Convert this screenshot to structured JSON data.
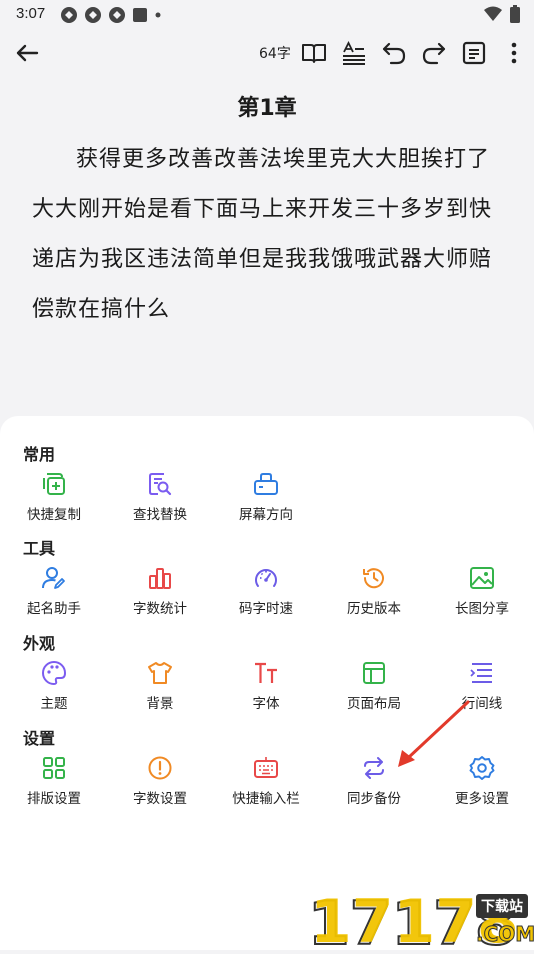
{
  "status": {
    "time": "3:07"
  },
  "toolbar": {
    "word_count": "64字"
  },
  "chapter": {
    "title": "第1章",
    "body": "获得更多改善改善法埃里克大大胆挨打了大大刚开始是看下面马上来开发三十多岁到快递店为我区违法简单但是我我饿哦武器大师赔偿款在搞什么"
  },
  "sheet": {
    "sections": [
      {
        "title": "常用",
        "items": [
          {
            "label": "快捷复制",
            "icon": "copy-add-icon",
            "color": "#34b34a"
          },
          {
            "label": "查找替换",
            "icon": "find-replace-icon",
            "color": "#7b5cf0"
          },
          {
            "label": "屏幕方向",
            "icon": "screen-rotate-icon",
            "color": "#2f7de1"
          }
        ]
      },
      {
        "title": "工具",
        "items": [
          {
            "label": "起名助手",
            "icon": "user-edit-icon",
            "color": "#2f7de1"
          },
          {
            "label": "字数统计",
            "icon": "bar-chart-icon",
            "color": "#e84848"
          },
          {
            "label": "码字时速",
            "icon": "speedometer-icon",
            "color": "#6c5ce7"
          },
          {
            "label": "历史版本",
            "icon": "history-icon",
            "color": "#f08a24"
          },
          {
            "label": "长图分享",
            "icon": "image-icon",
            "color": "#34b34a"
          }
        ]
      },
      {
        "title": "外观",
        "items": [
          {
            "label": "主题",
            "icon": "palette-icon",
            "color": "#7b5cf0"
          },
          {
            "label": "背景",
            "icon": "tshirt-icon",
            "color": "#f08a24"
          },
          {
            "label": "字体",
            "icon": "font-size-icon",
            "color": "#e84848"
          },
          {
            "label": "页面布局",
            "icon": "layout-icon",
            "color": "#34b34a"
          },
          {
            "label": "行间线",
            "icon": "line-spacing-icon",
            "color": "#6c5ce7"
          }
        ]
      },
      {
        "title": "设置",
        "items": [
          {
            "label": "排版设置",
            "icon": "grid-icon",
            "color": "#34b34a"
          },
          {
            "label": "字数设置",
            "icon": "alert-circle-icon",
            "color": "#f08a24"
          },
          {
            "label": "快捷输入栏",
            "icon": "keyboard-icon",
            "color": "#e84848"
          },
          {
            "label": "同步备份",
            "icon": "sync-icon",
            "color": "#6c5ce7"
          },
          {
            "label": "更多设置",
            "icon": "gear-icon",
            "color": "#2f7de1"
          }
        ]
      }
    ]
  },
  "watermark": {
    "text": "17178",
    "badge": "下载站",
    "suffix": ".COM"
  }
}
